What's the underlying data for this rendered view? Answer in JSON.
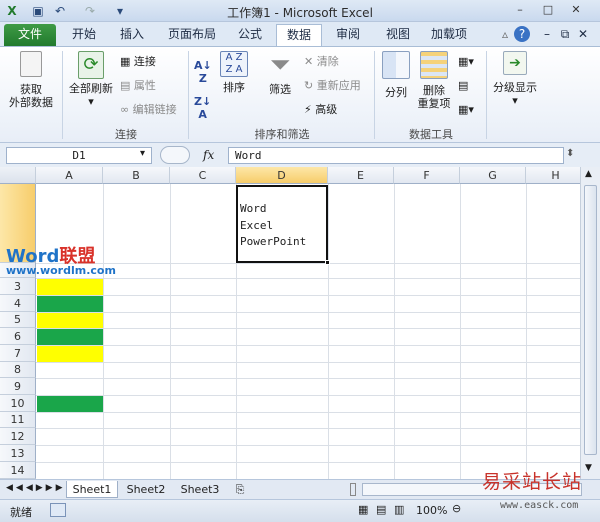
{
  "window": {
    "title": "工作簿1 - Microsoft Excel"
  },
  "tabs": [
    "文件",
    "开始",
    "插入",
    "页面布局",
    "公式",
    "数据",
    "审阅",
    "视图",
    "加载项"
  ],
  "ribbon": {
    "get_external": "获取\n外部数据",
    "refresh_all": "全部刷新",
    "connections": "连接",
    "properties": "属性",
    "edit_links": "编辑链接",
    "group_connections": "连接",
    "sort": "排序",
    "filter": "筛选",
    "clear": "清除",
    "reapply": "重新应用",
    "advanced": "高级",
    "group_sort": "排序和筛选",
    "text_to_columns": "分列",
    "remove_duplicates": "删除\n重复项",
    "group_tools": "数据工具",
    "outline": "分级显示"
  },
  "formula_bar": {
    "name_box": "D1",
    "fx": "fx",
    "formula": "Word"
  },
  "columns": [
    "A",
    "B",
    "C",
    "D",
    "E",
    "F",
    "G",
    "H"
  ],
  "rows": [
    "1",
    "2",
    "3",
    "4",
    "5",
    "6",
    "7",
    "8",
    "9",
    "10",
    "11",
    "12",
    "13",
    "14"
  ],
  "cell_d1_lines": [
    "Word",
    "Excel",
    "PowerPoint"
  ],
  "fills": {
    "yellow": "#ffff00",
    "green": "#1aa64a"
  },
  "sheet_tabs": [
    "Sheet1",
    "Sheet2",
    "Sheet3"
  ],
  "status": {
    "ready": "就绪",
    "zoom": "100%"
  },
  "watermark": {
    "brand_word": "Word",
    "brand_rest": "联盟",
    "brand_url": "www.wordlm.com",
    "site": "易采站长站",
    "site_url": "www.easck.com"
  }
}
